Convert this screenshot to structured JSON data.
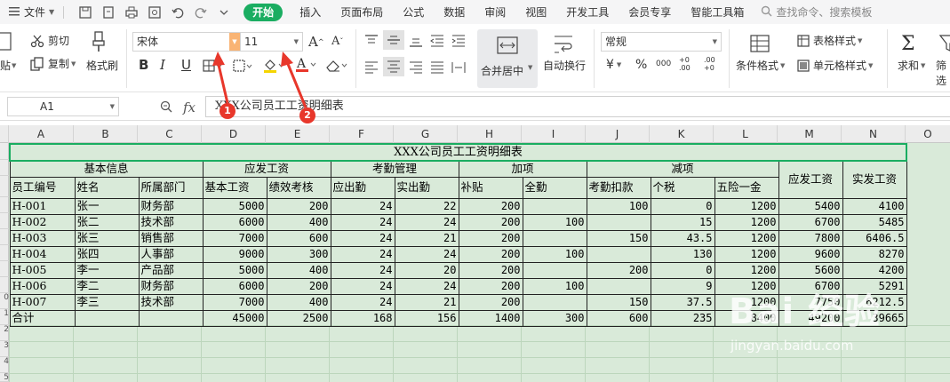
{
  "menubar": {
    "file_label": "文件",
    "tabs": [
      {
        "label": "开始"
      },
      {
        "label": "插入"
      },
      {
        "label": "页面布局"
      },
      {
        "label": "公式"
      },
      {
        "label": "数据"
      },
      {
        "label": "审阅"
      },
      {
        "label": "视图"
      },
      {
        "label": "开发工具"
      },
      {
        "label": "会员专享"
      },
      {
        "label": "智能工具箱"
      }
    ],
    "search_placeholder": "查找命令、搜索模板"
  },
  "ribbon": {
    "paste_label": "贴",
    "cut_label": "剪切",
    "copy_label": "复制",
    "format_painter_label": "格式刷",
    "font_name": "宋体",
    "font_size": "11",
    "merge_center_label": "合并居中",
    "wrap_text_label": "自动换行",
    "number_format": "常规",
    "conditional_format_label": "条件格式",
    "table_style_label": "表格样式",
    "cell_style_label": "单元格样式",
    "sum_label": "求和",
    "filter_label": "筛选",
    "currency_symbol": "¥",
    "percent_symbol": "%",
    "thousands_symbol": "000",
    "dec_inc": "+0 .00",
    "dec_dec": ".00 +0"
  },
  "annotations": {
    "badge1": "1",
    "badge2": "2"
  },
  "formula_bar": {
    "cell_ref": "A1",
    "fx_label": "fx",
    "value": "XXX公司员工工资明细表"
  },
  "columns": [
    "A",
    "B",
    "C",
    "D",
    "E",
    "F",
    "G",
    "H",
    "I",
    "J",
    "K",
    "L",
    "M",
    "N",
    "O"
  ],
  "row_numbers": [
    "",
    "",
    "",
    "",
    "",
    "",
    "",
    "",
    "",
    "0",
    "1",
    "2",
    "3",
    "4",
    "5",
    "6"
  ],
  "sheet": {
    "title": "XXX公司员工工资明细表",
    "groups": {
      "basic": "基本信息",
      "payable": "应发工资",
      "attendance": "考勤管理",
      "addition": "加项",
      "deduction": "减项",
      "gross": "应发工资",
      "net": "实发工资"
    },
    "headers": [
      "员工编号",
      "姓名",
      "所属部门",
      "基本工资",
      "绩效考核",
      "应出勤",
      "实出勤",
      "补贴",
      "全勤",
      "考勤扣款",
      "个税",
      "五险一金"
    ],
    "rows": [
      {
        "id": "H-001",
        "name": "张一",
        "dept": "财务部",
        "base": "5000",
        "perf": "200",
        "due": "24",
        "actual": "22",
        "subsidy": "200",
        "full": "",
        "deduct": "100",
        "tax": "0",
        "ins": "1200",
        "gross": "5400",
        "net": "4100"
      },
      {
        "id": "H-002",
        "name": "张二",
        "dept": "技术部",
        "base": "6000",
        "perf": "400",
        "due": "24",
        "actual": "24",
        "subsidy": "200",
        "full": "100",
        "deduct": "",
        "tax": "15",
        "ins": "1200",
        "gross": "6700",
        "net": "5485"
      },
      {
        "id": "H-003",
        "name": "张三",
        "dept": "销售部",
        "base": "7000",
        "perf": "600",
        "due": "24",
        "actual": "21",
        "subsidy": "200",
        "full": "",
        "deduct": "150",
        "tax": "43.5",
        "ins": "1200",
        "gross": "7800",
        "net": "6406.5"
      },
      {
        "id": "H-004",
        "name": "张四",
        "dept": "人事部",
        "base": "9000",
        "perf": "300",
        "due": "24",
        "actual": "24",
        "subsidy": "200",
        "full": "100",
        "deduct": "",
        "tax": "130",
        "ins": "1200",
        "gross": "9600",
        "net": "8270"
      },
      {
        "id": "H-005",
        "name": "李一",
        "dept": "产品部",
        "base": "5000",
        "perf": "400",
        "due": "24",
        "actual": "20",
        "subsidy": "200",
        "full": "",
        "deduct": "200",
        "tax": "0",
        "ins": "1200",
        "gross": "5600",
        "net": "4200"
      },
      {
        "id": "H-006",
        "name": "李二",
        "dept": "财务部",
        "base": "6000",
        "perf": "200",
        "due": "24",
        "actual": "24",
        "subsidy": "200",
        "full": "100",
        "deduct": "",
        "tax": "9",
        "ins": "1200",
        "gross": "6700",
        "net": "5291"
      },
      {
        "id": "H-007",
        "name": "李三",
        "dept": "技术部",
        "base": "7000",
        "perf": "400",
        "due": "24",
        "actual": "21",
        "subsidy": "200",
        "full": "",
        "deduct": "150",
        "tax": "37.5",
        "ins": "1200",
        "gross": "7750",
        "net": "6212.5"
      }
    ],
    "total": {
      "label": "合计",
      "base": "45000",
      "perf": "2500",
      "due": "168",
      "actual": "156",
      "subsidy": "1400",
      "full": "300",
      "deduct": "600",
      "tax": "235",
      "ins": "8400",
      "gross": "49200",
      "net": "39665"
    }
  },
  "watermark": {
    "logo": "Bai 经验",
    "url": "jingyan.baidu.com"
  }
}
